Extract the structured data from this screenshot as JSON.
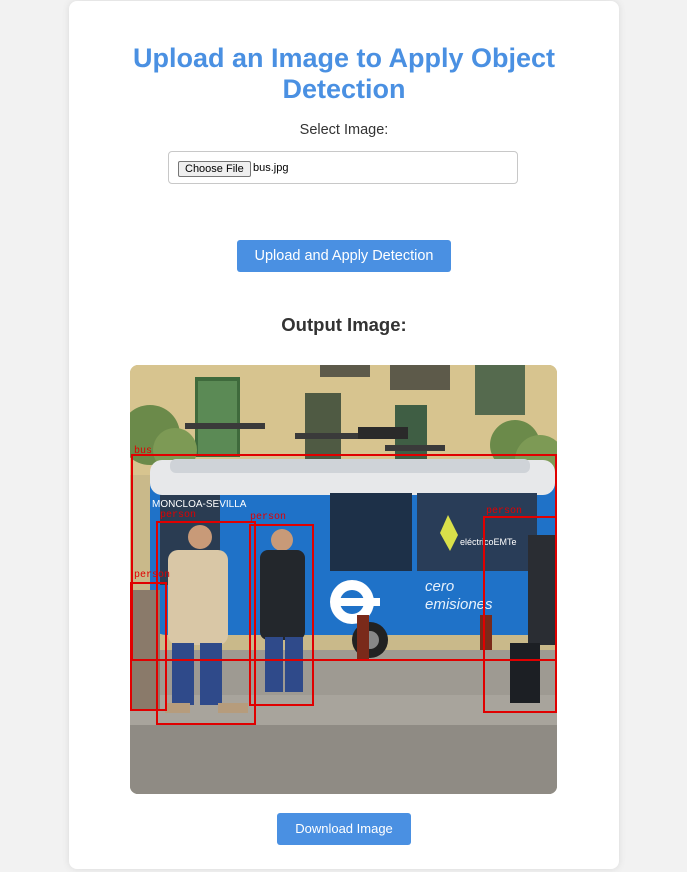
{
  "page": {
    "title": "Upload an Image to Apply Object Detection",
    "select_label": "Select Image:",
    "file_input": {
      "button_label": "Choose File",
      "file_name": "bus.jpg"
    },
    "upload_button": "Upload and Apply Detection",
    "output_heading": "Output Image:",
    "download_button": "Download Image"
  },
  "output_image": {
    "detections": [
      {
        "label": "bus"
      },
      {
        "label": "person"
      },
      {
        "label": "person"
      },
      {
        "label": "person"
      },
      {
        "label": "person"
      }
    ],
    "bus_text": {
      "destination": "MONCLOA-SEVILLA",
      "brand": "eléctricoEMTe",
      "side_text_1": "cero",
      "side_text_2": "emisiones"
    }
  },
  "colors": {
    "accent": "#4a90e2",
    "box": "#e00000",
    "background": "#f2f2f2"
  }
}
